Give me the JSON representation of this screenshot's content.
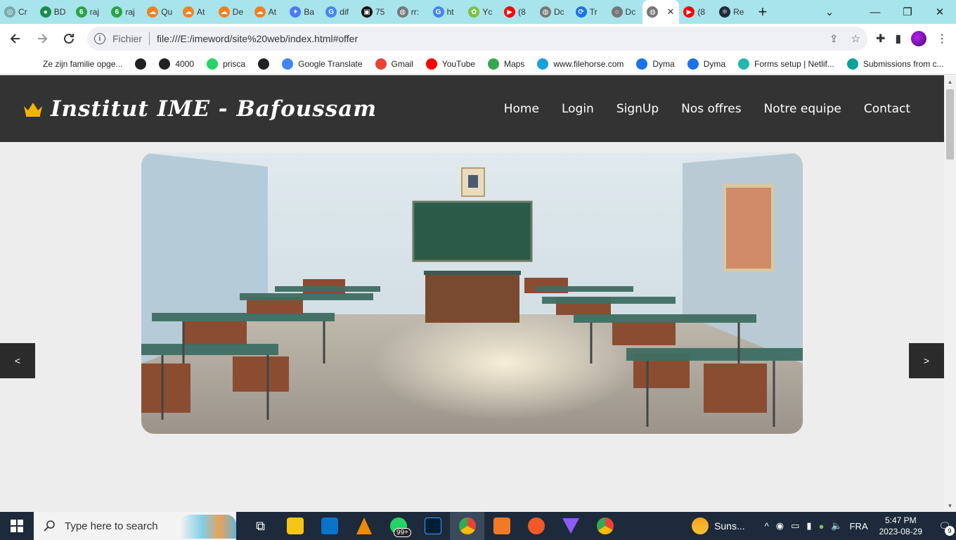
{
  "browser": {
    "tabs": [
      {
        "label": "Cr",
        "color": "#7aa",
        "glyph": "◎"
      },
      {
        "label": "BD",
        "color": "#1a8f4a",
        "glyph": "●"
      },
      {
        "label": "raj",
        "color": "#2aa34a",
        "glyph": "6"
      },
      {
        "label": "raj",
        "color": "#2aa34a",
        "glyph": "6"
      },
      {
        "label": "Qu",
        "color": "#f38020",
        "glyph": "☁"
      },
      {
        "label": "At",
        "color": "#f38020",
        "glyph": "☁"
      },
      {
        "label": "De",
        "color": "#f38020",
        "glyph": "☁"
      },
      {
        "label": "At",
        "color": "#f38020",
        "glyph": "☁"
      },
      {
        "label": "Ba",
        "color": "#4a7cf0",
        "glyph": "✦"
      },
      {
        "label": "dif",
        "color": "#4285f4",
        "glyph": "G"
      },
      {
        "label": "75",
        "color": "#111111",
        "glyph": "▣"
      },
      {
        "label": "rr:",
        "color": "#777777",
        "glyph": "◍"
      },
      {
        "label": "ht",
        "color": "#4285f4",
        "glyph": "G"
      },
      {
        "label": "Yc",
        "color": "#7bc142",
        "glyph": "✿"
      },
      {
        "label": "(8",
        "color": "#ff0000",
        "glyph": "▶"
      },
      {
        "label": "Dc",
        "color": "#777777",
        "glyph": "◍"
      },
      {
        "label": "Tr",
        "color": "#1a73e8",
        "glyph": "⟳"
      },
      {
        "label": "Dc",
        "color": "#777777",
        "glyph": "○"
      },
      {
        "label": "",
        "color": "#777777",
        "glyph": "◍",
        "active": true
      },
      {
        "label": "(8",
        "color": "#ff0000",
        "glyph": "▶"
      },
      {
        "label": "Re",
        "color": "#1e2a3a",
        "glyph": "⚛"
      }
    ],
    "new_tab": "+",
    "window_controls": {
      "dropdown": "⌄",
      "minimize": "—",
      "restore": "❐",
      "close": "✕"
    },
    "address": {
      "scheme_label": "Fichier",
      "url": "file:///E:/imeword/site%20web/index.html#offer"
    },
    "bookmarks": [
      {
        "label": "Ze zijn familie opge...",
        "color": "#ffffff"
      },
      {
        "label": "",
        "color": "#222222"
      },
      {
        "label": "4000",
        "color": "#222222"
      },
      {
        "label": "prisca",
        "color": "#25d366"
      },
      {
        "label": "",
        "color": "#222222"
      },
      {
        "label": "Google Translate",
        "color": "#4285f4"
      },
      {
        "label": "Gmail",
        "color": "#ea4335"
      },
      {
        "label": "YouTube",
        "color": "#ff0000"
      },
      {
        "label": "Maps",
        "color": "#34a853"
      },
      {
        "label": "www.filehorse.com",
        "color": "#1a9fd9"
      },
      {
        "label": "Dyma",
        "color": "#1a73e8"
      },
      {
        "label": "Dyma",
        "color": "#1a73e8"
      },
      {
        "label": "Forms setup | Netlif...",
        "color": "#22b8b0"
      },
      {
        "label": "Submissions from c...",
        "color": "#0aa39a"
      }
    ],
    "bookmarks_more": "»"
  },
  "site": {
    "brand": "Institut IME - Bafoussam",
    "nav": [
      "Home",
      "Login",
      "SignUp",
      "Nos offres",
      "Notre equipe",
      "Contact"
    ],
    "slider": {
      "prev": "<",
      "next": ">"
    }
  },
  "taskbar": {
    "search_placeholder": "Type here to search",
    "whatsapp_badge": "99+",
    "weather": "Suns...",
    "language": "FRA",
    "time": "5:47 PM",
    "date": "2023-08-29",
    "notifications": "9"
  }
}
